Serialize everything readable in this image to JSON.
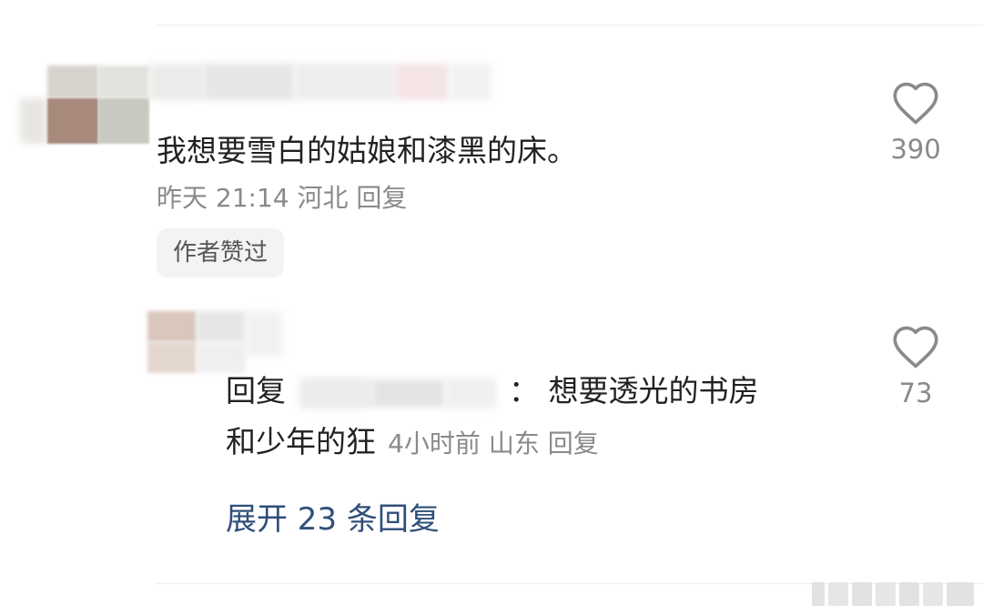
{
  "comment": {
    "text": "我想要雪白的姑娘和漆黑的床。",
    "meta_time": "昨天 21:14",
    "meta_location": "河北",
    "reply_label": "回复",
    "badge": "作者赞过",
    "likes": "390"
  },
  "sub_comment": {
    "prefix": "回复",
    "colon": "：",
    "text_line1": "想要透光的书房",
    "text_line2": "和少年的狂",
    "meta_time": "4小时前",
    "meta_location": "山东",
    "reply_label": "回复",
    "likes": "73"
  },
  "expand_label": "展开 23 条回复",
  "icons": {
    "like": "heart-outline-icon"
  },
  "colors": {
    "link": "#2f4f7a",
    "meta": "#8a8a8a",
    "text": "#222222"
  }
}
